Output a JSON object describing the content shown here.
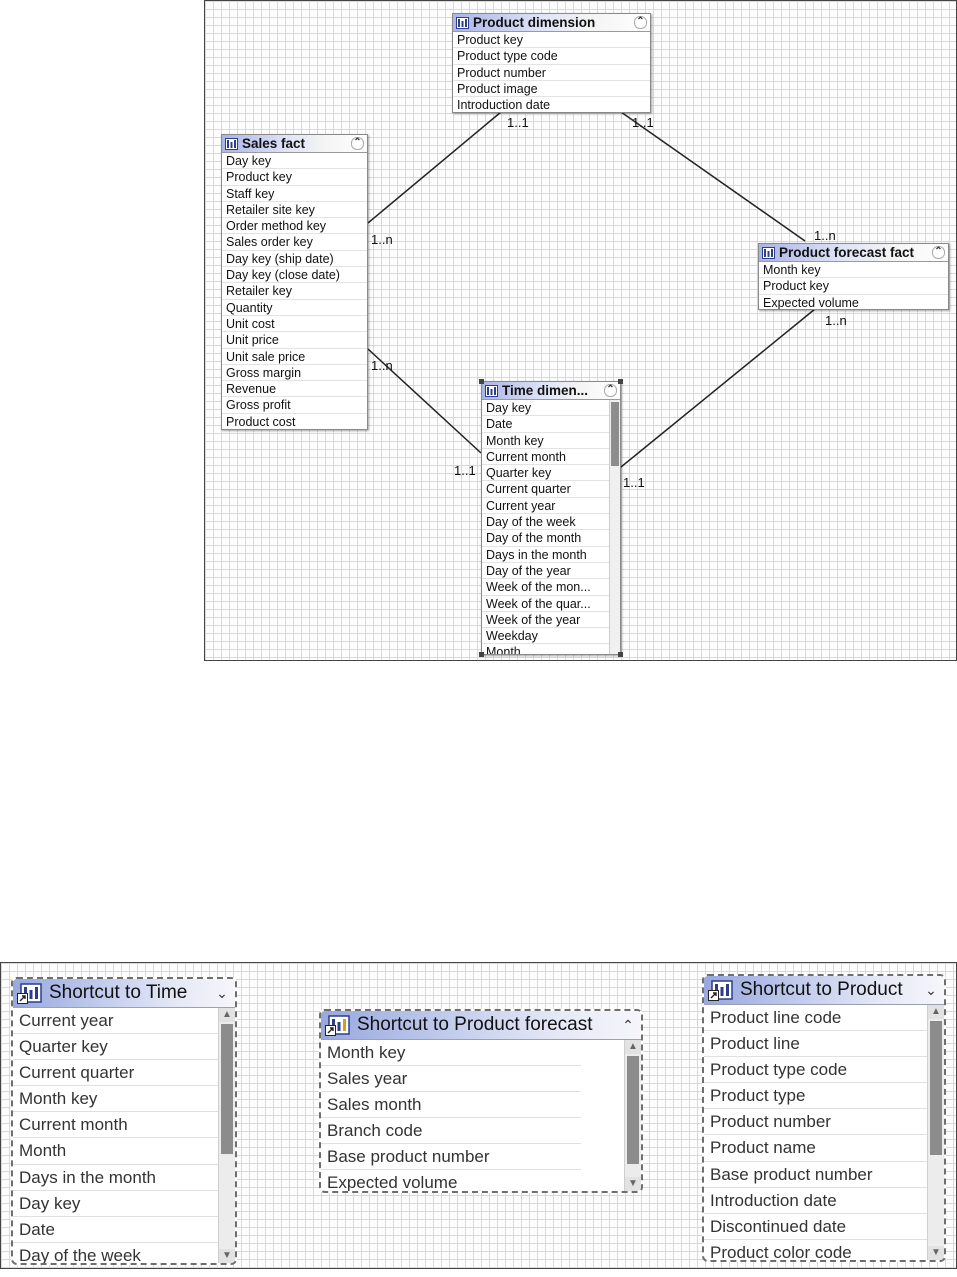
{
  "top_diagram": {
    "entities": {
      "product_dimension": {
        "title": "Product dimension",
        "fields": [
          "Product key",
          "Product type code",
          "Product number",
          "Product image",
          "Introduction date"
        ]
      },
      "sales_fact": {
        "title": "Sales fact",
        "fields": [
          "Day key",
          "Product key",
          "Staff key",
          "Retailer site key",
          "Order method key",
          "Sales order key",
          "Day key (ship date)",
          "Day key (close date)",
          "Retailer key",
          "Quantity",
          "Unit cost",
          "Unit price",
          "Unit sale price",
          "Gross margin",
          "Revenue",
          "Gross profit",
          "Product cost"
        ]
      },
      "product_forecast_fact": {
        "title": "Product forecast fact",
        "fields": [
          "Month key",
          "Product key",
          "Expected volume"
        ]
      },
      "time_dimension": {
        "title": "Time dimen...",
        "fields": [
          "Day key",
          "Date",
          "Month key",
          "Current month",
          "Quarter key",
          "Current quarter",
          "Current year",
          "Day of the week",
          "Day of the month",
          "Days in the month",
          "Day of the year",
          "Week of the mon...",
          "Week of the quar...",
          "Week of the year",
          "Weekday",
          "Month"
        ]
      }
    },
    "relationships": [
      {
        "from": "sales_fact",
        "to": "product_dimension",
        "from_card": "1..n",
        "to_card": "1..1"
      },
      {
        "from": "product_forecast_fact",
        "to": "product_dimension",
        "from_card": "1..n",
        "to_card": "1..1"
      },
      {
        "from": "sales_fact",
        "to": "time_dimension",
        "from_card": "1..n",
        "to_card": "1..1"
      },
      {
        "from": "product_forecast_fact",
        "to": "time_dimension",
        "from_card": "1..n",
        "to_card": "1..1"
      }
    ]
  },
  "bottom_diagram": {
    "shortcut_time": {
      "title": "Shortcut to Time",
      "fields": [
        "Current year",
        "Quarter key",
        "Current quarter",
        "Month key",
        "Current month",
        "Month",
        "Days in the month",
        "Day key",
        "Date",
        "Day of the week"
      ]
    },
    "shortcut_forecast": {
      "title": "Shortcut to Product forecast",
      "fields": [
        "Month key",
        "Sales year",
        "Sales month",
        "Branch code",
        "Base product number",
        "Expected volume"
      ]
    },
    "shortcut_product": {
      "title": "Shortcut to Product",
      "fields": [
        "Product line code",
        "Product line",
        "Product type code",
        "Product type",
        "Product number",
        "Product name",
        "Base product number",
        "Introduction date",
        "Discontinued date",
        "Product color code"
      ]
    }
  },
  "icons": {
    "entity": "query-subject-icon",
    "shortcut": "shortcut-query-subject-icon",
    "collapse": "chevron-up-icon",
    "expand": "chevron-down-icon"
  },
  "colors": {
    "header_gradient_start": "#aab4e6",
    "grid": "#d9d9d9",
    "thumb": "#8d8d8d"
  }
}
